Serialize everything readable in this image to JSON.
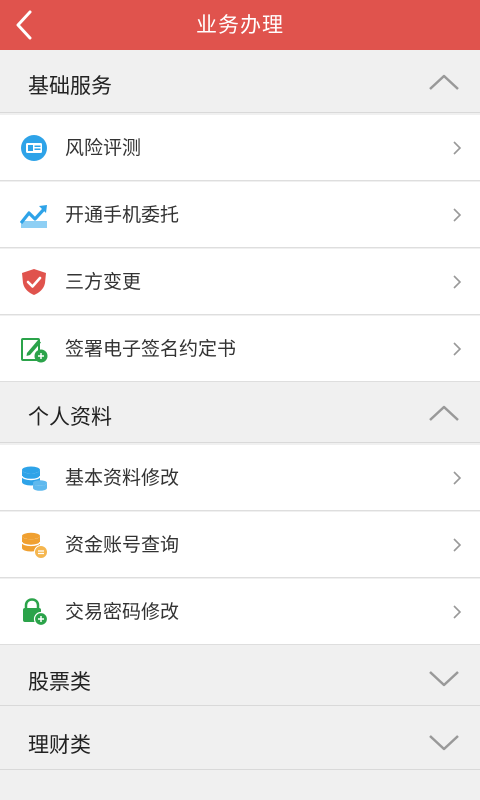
{
  "header": {
    "title": "业务办理"
  },
  "sections": [
    {
      "title": "基础服务",
      "items": [
        {
          "label": "风险评测",
          "icon": "id-card-icon",
          "color": "#2ea3e8"
        },
        {
          "label": "开通手机委托",
          "icon": "trend-chart-icon",
          "color": "#2ea3e8"
        },
        {
          "label": "三方变更",
          "icon": "shield-icon",
          "color": "#e0534d"
        },
        {
          "label": "签署电子签名约定书",
          "icon": "sign-pen-icon",
          "color": "#2ba34a"
        }
      ]
    },
    {
      "title": "个人资料",
      "items": [
        {
          "label": "基本资料修改",
          "icon": "database-icon",
          "color": "#2ea3e8"
        },
        {
          "label": "资金账号查询",
          "icon": "coins-icon",
          "color": "#f0a030"
        },
        {
          "label": "交易密码修改",
          "icon": "lock-icon",
          "color": "#2ba34a"
        }
      ]
    },
    {
      "title": "股票类",
      "items": []
    },
    {
      "title": "理财类",
      "items": []
    }
  ],
  "colors": {
    "accent": "#e0534d",
    "background": "#f0f0f0"
  }
}
